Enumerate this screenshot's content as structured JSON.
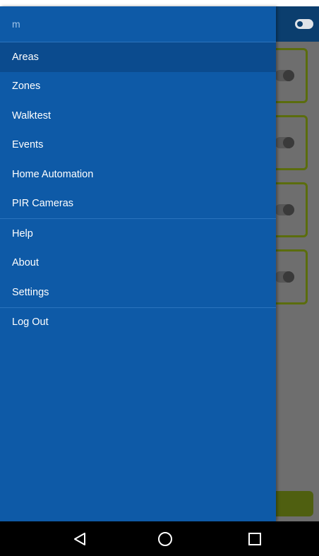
{
  "drawer": {
    "header_text": "m",
    "primary_items": [
      {
        "label": "Areas",
        "active": true
      },
      {
        "label": "Zones",
        "active": false
      },
      {
        "label": "Walktest",
        "active": false
      },
      {
        "label": "Events",
        "active": false
      },
      {
        "label": "Home Automation",
        "active": false
      },
      {
        "label": "PIR Cameras",
        "active": false
      }
    ],
    "secondary_items": [
      {
        "label": "Help"
      },
      {
        "label": "About"
      },
      {
        "label": "Settings"
      }
    ],
    "logout_label": "Log Out"
  },
  "navbar": {
    "icons": [
      "back-icon",
      "home-icon",
      "recents-icon"
    ]
  },
  "colors": {
    "drawer_bg": "#0e5aa7",
    "active_item_bg": "#0b4b8e",
    "app_header": "#0b3e6e",
    "card_border": "#5b6d0d",
    "action_button": "#4f5f10"
  }
}
